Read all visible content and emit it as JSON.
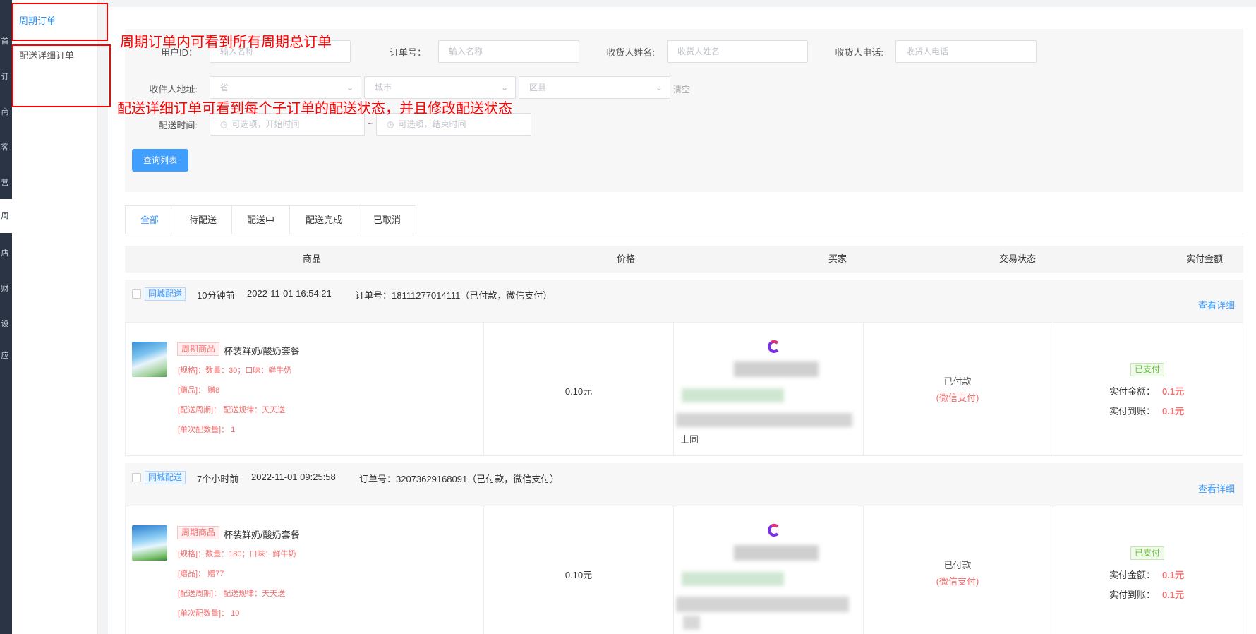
{
  "sidebar": {
    "rail_glyphs": [
      "首",
      "订",
      "商",
      "客",
      "营",
      "周",
      "店",
      "财",
      "设",
      "应"
    ],
    "items": [
      {
        "label": "周期订单",
        "active": true
      },
      {
        "label": "配送详细订单",
        "active": false
      }
    ]
  },
  "filters": {
    "user_id": {
      "label": "用户ID：",
      "placeholder": "输入名称"
    },
    "order_no": {
      "label": "订单号：",
      "placeholder": "输入名称"
    },
    "receiver_name": {
      "label": "收货人姓名:",
      "placeholder": "收货人姓名"
    },
    "receiver_phone": {
      "label": "收货人电话:",
      "placeholder": "收货人电话"
    },
    "address": {
      "label": "收件人地址:",
      "province": "省",
      "city": "城市",
      "district": "区县",
      "clear": "清空"
    },
    "delivery_time": {
      "label": "配送时间:",
      "start_placeholder": "可选项，开始时间",
      "separator": "~",
      "end_placeholder": "可选项，结束时间"
    },
    "query_button": "查询列表"
  },
  "tabs": [
    "全部",
    "待配送",
    "配送中",
    "配送完成",
    "已取消"
  ],
  "active_tab": "全部",
  "table_headers": [
    "商品",
    "价格",
    "买家",
    "交易状态",
    "实付金额"
  ],
  "orders": [
    {
      "delivery_tag": "同城配送",
      "relative_time": "10分钟前",
      "datetime": "2022-11-01 16:54:21",
      "order_info": "订单号：18111277014111（已付款，微信支付）",
      "detail_link": "查看详细",
      "product_tag": "周期商品",
      "product_name": "杯装鲜奶/酸奶套餐",
      "spec": "[规格]：数量：30；口味：鲜牛奶",
      "gift": "[赠品]： 赠8",
      "cycle": "[配送周期]： 配送规律：天天送",
      "per_qty": "[单次配数量]： 1",
      "price": "0.10元",
      "buyer_note": "士同",
      "trade_status": "已付款",
      "pay_method": "(微信支付)",
      "pay_badge": "已支付",
      "paid_label": "实付金额：",
      "paid_value": "0.1元",
      "received_label": "实付到账：",
      "received_value": "0.1元"
    },
    {
      "delivery_tag": "同城配送",
      "relative_time": "7个小时前",
      "datetime": "2022-11-01 09:25:58",
      "order_info": "订单号：32073629168091（已付款，微信支付）",
      "detail_link": "查看详细",
      "product_tag": "周期商品",
      "product_name": "杯装鲜奶/酸奶套餐",
      "spec": "[规格]：数量：180；口味：鲜牛奶",
      "gift": "[赠品]： 赠77",
      "cycle": "[配送周期]： 配送规律：天天送",
      "per_qty": "[单次配数量]： 10",
      "price": "0.10元",
      "buyer_note": "",
      "trade_status": "已付款",
      "pay_method": "(微信支付)",
      "pay_badge": "已支付",
      "paid_label": "实付金额：",
      "paid_value": "0.1元",
      "received_label": "实付到账：",
      "received_value": "0.1元"
    }
  ],
  "annotations": {
    "note1": "周期订单内可看到所有周期总订单",
    "note2": "配送详细订单可看到每个子订单的配送状态，并且修改配送状态"
  },
  "colors": {
    "accent": "#409eff",
    "danger": "#f56c6c",
    "success": "#67c23a",
    "annotation": "#ff0000",
    "rail": "#2b3445"
  }
}
